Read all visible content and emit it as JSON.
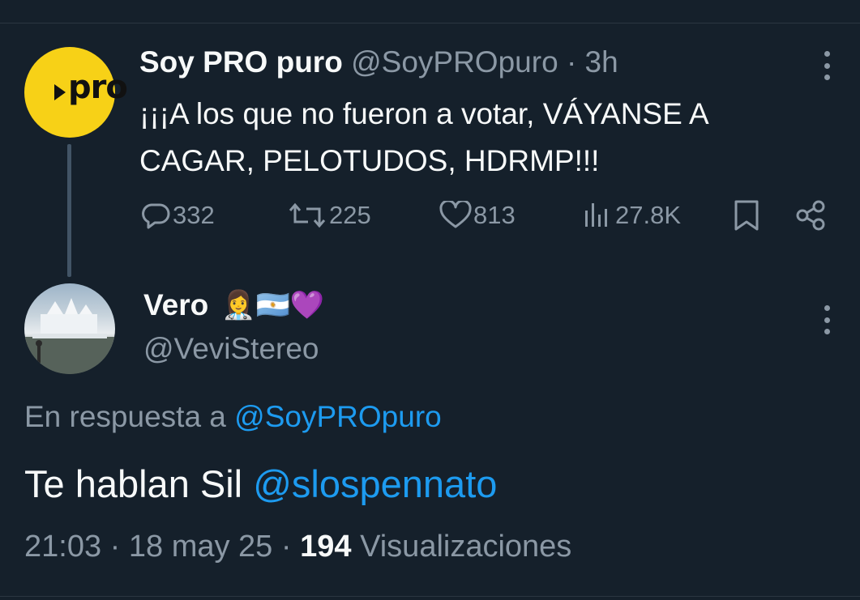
{
  "parent_tweet": {
    "author_name": "Soy PRO puro",
    "handle": "@SoyPROpuro",
    "separator": "·",
    "time": "3h",
    "avatar_text": "pro",
    "text": "¡¡¡A los que no fueron a votar, VÁYANSE A CAGAR, PELOTUDOS, HDRMP!!!",
    "stats": {
      "replies": "332",
      "retweets": "225",
      "likes": "813",
      "views": "27.8K"
    },
    "icons": [
      "reply-icon",
      "retweet-icon",
      "like-icon",
      "views-icon",
      "bookmark-icon",
      "share-icon"
    ]
  },
  "reply_tweet": {
    "author_name": "Vero",
    "name_emojis": "👩‍⚕️🇦🇷💜",
    "handle": "@VeviStereo",
    "in_reply_prefix": "En respuesta a",
    "in_reply_handle": "@SoyPROpuro",
    "text": "Te hablan Sil",
    "mention": "@slospennato",
    "time": "21:03",
    "separator": "·",
    "date": "18 may 25",
    "views_count": "194",
    "views_label": "Visualizaciones"
  },
  "colors": {
    "background": "#15202b",
    "text": "#f7f9f9",
    "secondary": "#8b98a5",
    "link": "#1d9bf0",
    "pro_brand": "#f7d117"
  }
}
